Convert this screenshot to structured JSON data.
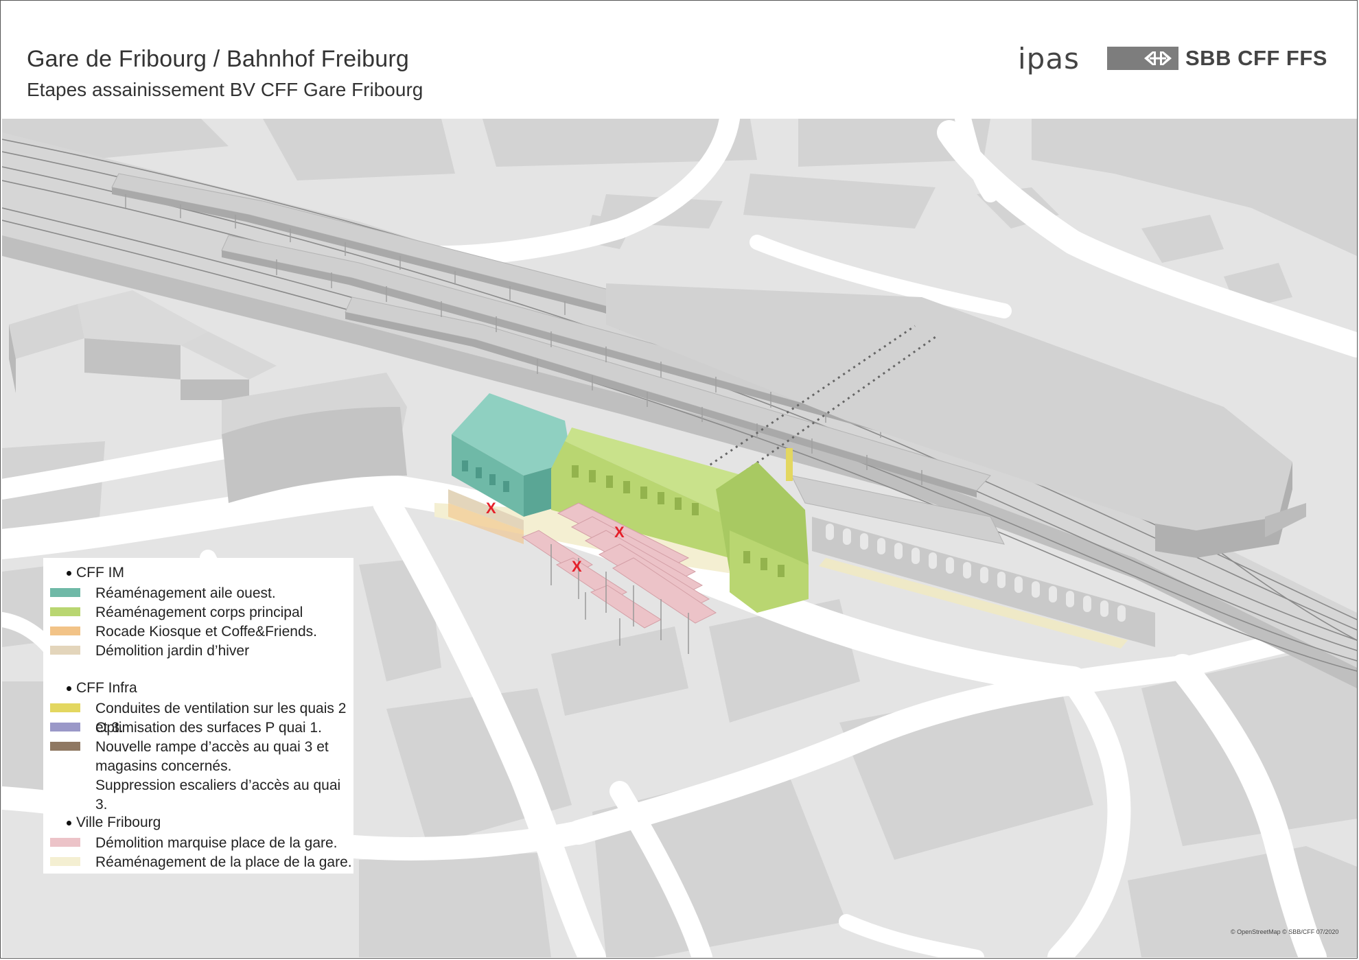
{
  "header": {
    "title": "Gare de Fribourg / Bahnhof Freiburg",
    "subtitle": "Etapes assainissement BV CFF Gare Fribourg",
    "logo_ipas": "ipas",
    "logo_sbb": "SBB CFF FFS"
  },
  "colors": {
    "map_background": "#e4e4e4",
    "street": "#ffffff",
    "block": "#cfcfcf",
    "building_roof": "#d9d9d9",
    "building_side": "#bdbdbd",
    "track_line": "#8a8a8a",
    "logo_grey": "#7d7d7d",
    "marker_red": "#e5202a"
  },
  "map": {
    "markers": [
      "X",
      "X",
      "X"
    ]
  },
  "legend": {
    "groups": [
      {
        "title": "CFF IM",
        "items": [
          {
            "label": "Réaménagement aile ouest.",
            "color": "#6fb9a7"
          },
          {
            "label": "Réaménagement corps principal",
            "color": "#b9d671"
          },
          {
            "label": "Rocade Kiosque et Coffe&Friends.",
            "color": "#f2c387"
          },
          {
            "label": "Démolition jardin d’hiver",
            "color": "#e3d5bb"
          }
        ]
      },
      {
        "title": "CFF Infra",
        "items": [
          {
            "label": "Conduites de ventilation sur les quais 2 et 3.",
            "color": "#e3d760"
          },
          {
            "label": "Optimisation des surfaces P quai 1.",
            "color": "#9a98c8"
          },
          {
            "label": "Nouvelle rampe d’accès au quai 3 et\nmagasins concernés.\nSuppression escaliers d’accès au quai 3.",
            "color": "#8f7862"
          }
        ]
      },
      {
        "title": "Ville Fribourg",
        "items": [
          {
            "label": "Démolition marquise place de la gare.",
            "color": "#ecc3c8"
          },
          {
            "label": "Réaménagement de la place de la gare.",
            "color": "#f4efd2"
          }
        ]
      }
    ]
  },
  "footer": {
    "copyright": "© OpenStreetMap  © SBB/CFF 07/2020"
  }
}
